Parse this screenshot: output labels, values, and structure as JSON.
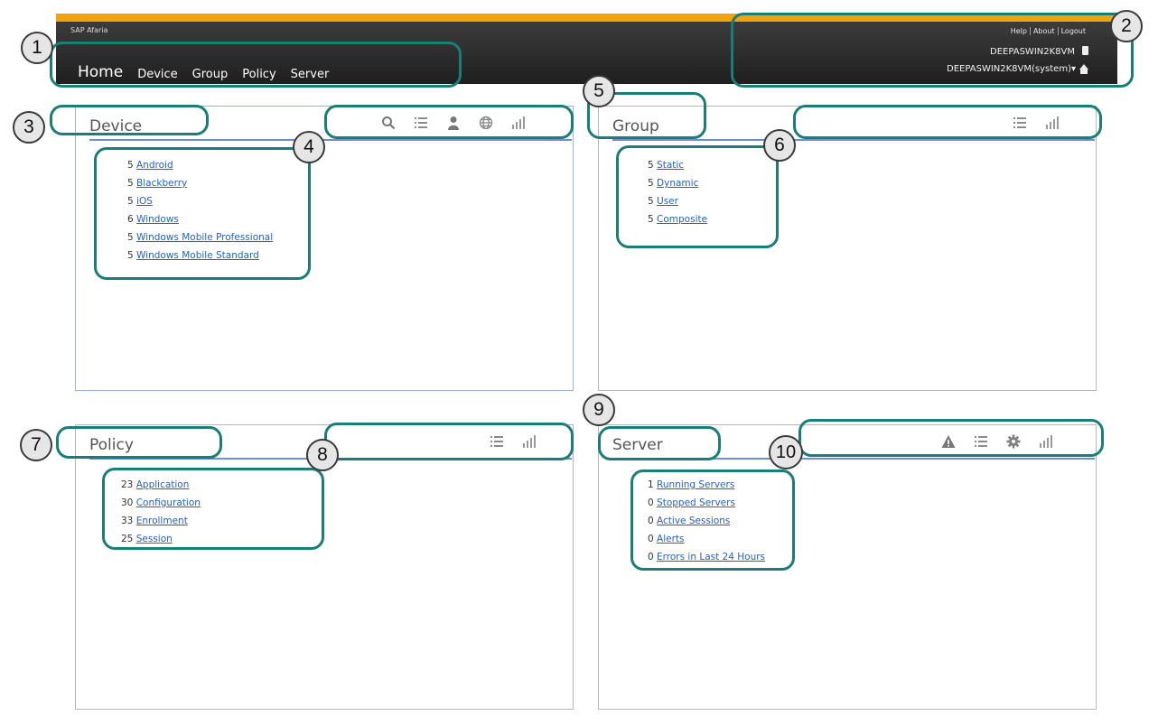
{
  "header": {
    "brand": "SAP Afaria",
    "nav": [
      "Home",
      "Device",
      "Group",
      "Policy",
      "Server"
    ],
    "links": [
      "Help",
      "About",
      "Logout"
    ],
    "host": "DEEPASWIN2K8VM",
    "system": "DEEPASWIN2K8VM(system)▾"
  },
  "panels": {
    "device": {
      "title": "Device",
      "icons": [
        "search-icon",
        "list-icon",
        "user-icon",
        "globe-icon",
        "chart-icon"
      ],
      "items": [
        {
          "count": "5",
          "label": "Android"
        },
        {
          "count": "5",
          "label": "Blackberry"
        },
        {
          "count": "5",
          "label": "iOS"
        },
        {
          "count": "6",
          "label": "Windows"
        },
        {
          "count": "5",
          "label": "Windows Mobile Professional"
        },
        {
          "count": "5",
          "label": "Windows Mobile Standard"
        }
      ]
    },
    "group": {
      "title": "Group",
      "icons": [
        "list-icon",
        "chart-icon"
      ],
      "items": [
        {
          "count": "5",
          "label": "Static"
        },
        {
          "count": "5",
          "label": "Dynamic"
        },
        {
          "count": "5",
          "label": "User"
        },
        {
          "count": "5",
          "label": "Composite"
        }
      ]
    },
    "policy": {
      "title": "Policy",
      "icons": [
        "list-icon",
        "chart-icon"
      ],
      "items": [
        {
          "count": "23",
          "label": "Application"
        },
        {
          "count": "30",
          "label": "Configuration"
        },
        {
          "count": "33",
          "label": "Enrollment"
        },
        {
          "count": "25",
          "label": "Session"
        }
      ]
    },
    "server": {
      "title": "Server",
      "icons": [
        "alert-icon",
        "list-icon",
        "gear-icon",
        "chart-icon"
      ],
      "items": [
        {
          "count": "1",
          "label": "Running Servers"
        },
        {
          "count": "0",
          "label": "Stopped Servers"
        },
        {
          "count": "0",
          "label": "Active Sessions"
        },
        {
          "count": "0",
          "label": "Alerts"
        },
        {
          "count": "0",
          "label": "Errors in Last 24 Hours"
        }
      ]
    }
  },
  "callouts": [
    "1",
    "2",
    "3",
    "4",
    "5",
    "6",
    "7",
    "8",
    "9",
    "10"
  ],
  "colors": {
    "accent_bar": "#f0a30a",
    "callout": "#1a7d78",
    "link": "#2462c8",
    "rule": "#6c8fd2"
  }
}
